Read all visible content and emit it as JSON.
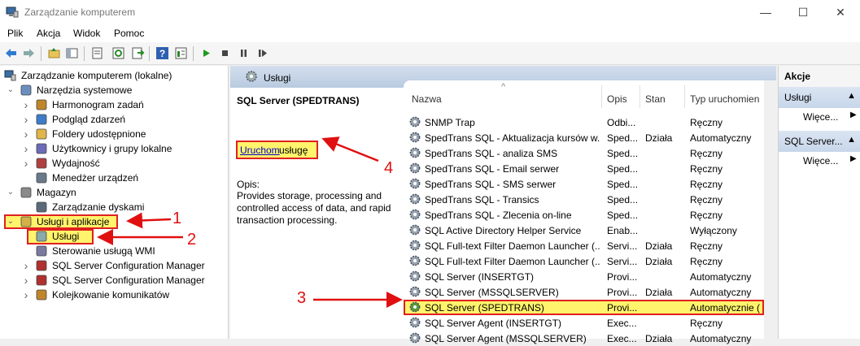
{
  "window": {
    "title": "Zarządzanie komputerem",
    "controls": [
      "—",
      "☐",
      "✕"
    ]
  },
  "menu": [
    "Plik",
    "Akcja",
    "Widok",
    "Pomoc"
  ],
  "toolbar": {
    "icons": [
      "back-icon",
      "forward-icon",
      "up-folder-icon",
      "show-tree-icon",
      "properties-icon",
      "refresh-icon",
      "export-icon",
      "help-icon",
      "details-icon",
      "play-icon",
      "stop-icon",
      "pause-icon",
      "restart-icon"
    ]
  },
  "tree": {
    "root": "Zarządzanie komputerem (lokalne)",
    "items": [
      {
        "label": "Narzędzia systemowe",
        "level": 1,
        "expand": "open"
      },
      {
        "label": "Harmonogram zadań",
        "level": 2,
        "expand": "closed"
      },
      {
        "label": "Podgląd zdarzeń",
        "level": 2,
        "expand": "closed"
      },
      {
        "label": "Foldery udostępnione",
        "level": 2,
        "expand": "closed"
      },
      {
        "label": "Użytkownicy i grupy lokalne",
        "level": 2,
        "expand": "closed"
      },
      {
        "label": "Wydajność",
        "level": 2,
        "expand": "closed"
      },
      {
        "label": "Menedżer urządzeń",
        "level": 2,
        "expand": "none"
      },
      {
        "label": "Magazyn",
        "level": 1,
        "expand": "open"
      },
      {
        "label": "Zarządzanie dyskami",
        "level": 2,
        "expand": "none"
      },
      {
        "label": "Usługi i aplikacje",
        "level": 1,
        "expand": "open",
        "highlight": true
      },
      {
        "label": "Usługi",
        "level": 2,
        "expand": "none",
        "highlight": true
      },
      {
        "label": "Sterowanie usługą WMI",
        "level": 2,
        "expand": "none"
      },
      {
        "label": "SQL Server Configuration Manager",
        "level": 2,
        "expand": "closed"
      },
      {
        "label": "SQL Server Configuration Manager",
        "level": 2,
        "expand": "closed"
      },
      {
        "label": "Kolejkowanie komunikatów",
        "level": 2,
        "expand": "closed"
      }
    ]
  },
  "middle": {
    "header": "Usługi",
    "selected_service": "SQL Server (SPEDTRANS)",
    "start_link": "Uruchom",
    "start_rest": "usługę",
    "desc_label": "Opis:",
    "description": "Provides storage, processing and controlled access of data, and rapid transaction processing."
  },
  "list": {
    "sort_arrow": "^",
    "columns": [
      "Nazwa",
      "Opis",
      "Stan",
      "Typ uruchomien"
    ],
    "rows": [
      {
        "name": "SNMP Trap",
        "desc": "Odbi...",
        "state": "",
        "type": "Ręczny"
      },
      {
        "name": "SpedTrans SQL - Aktualizacja kursów w...",
        "desc": "Sped...",
        "state": "Działa",
        "type": "Automatyczny"
      },
      {
        "name": "SpedTrans SQL - analiza SMS",
        "desc": "Sped...",
        "state": "",
        "type": "Ręczny"
      },
      {
        "name": "SpedTrans SQL - Email serwer",
        "desc": "Sped...",
        "state": "",
        "type": "Ręczny"
      },
      {
        "name": "SpedTrans SQL - SMS serwer",
        "desc": "Sped...",
        "state": "",
        "type": "Ręczny"
      },
      {
        "name": "SpedTrans SQL - Transics",
        "desc": "Sped...",
        "state": "",
        "type": "Ręczny"
      },
      {
        "name": "SpedTrans SQL - Zlecenia on-line",
        "desc": "Sped...",
        "state": "",
        "type": "Ręczny"
      },
      {
        "name": "SQL Active Directory Helper Service",
        "desc": "Enab...",
        "state": "",
        "type": "Wyłączony"
      },
      {
        "name": "SQL Full-text Filter Daemon Launcher (...",
        "desc": "Servi...",
        "state": "Działa",
        "type": "Ręczny"
      },
      {
        "name": "SQL Full-text Filter Daemon Launcher (...",
        "desc": "Servi...",
        "state": "Działa",
        "type": "Ręczny"
      },
      {
        "name": "SQL Server (INSERTGT)",
        "desc": "Provi...",
        "state": "",
        "type": "Automatyczny"
      },
      {
        "name": "SQL Server (MSSQLSERVER)",
        "desc": "Provi...",
        "state": "Działa",
        "type": "Automatyczny"
      },
      {
        "name": "SQL Server (SPEDTRANS)",
        "desc": "Provi...",
        "state": "",
        "type": "Automatycznie (",
        "selected": true
      },
      {
        "name": "SQL Server Agent (INSERTGT)",
        "desc": "Exec...",
        "state": "",
        "type": "Ręczny"
      },
      {
        "name": "SQL Server Agent (MSSQLSERVER)",
        "desc": "Exec...",
        "state": "Działa",
        "type": "Automatyczny"
      }
    ]
  },
  "actions": {
    "title": "Akcje",
    "sections": [
      {
        "header": "Usługi",
        "more": "Więce..."
      },
      {
        "header": "SQL Server...",
        "more": "Więce..."
      }
    ]
  },
  "annotations": [
    "1",
    "2",
    "3",
    "4"
  ],
  "colors": {
    "highlight": "#fff46b",
    "annotation": "#e01010",
    "link": "#0000cc"
  }
}
